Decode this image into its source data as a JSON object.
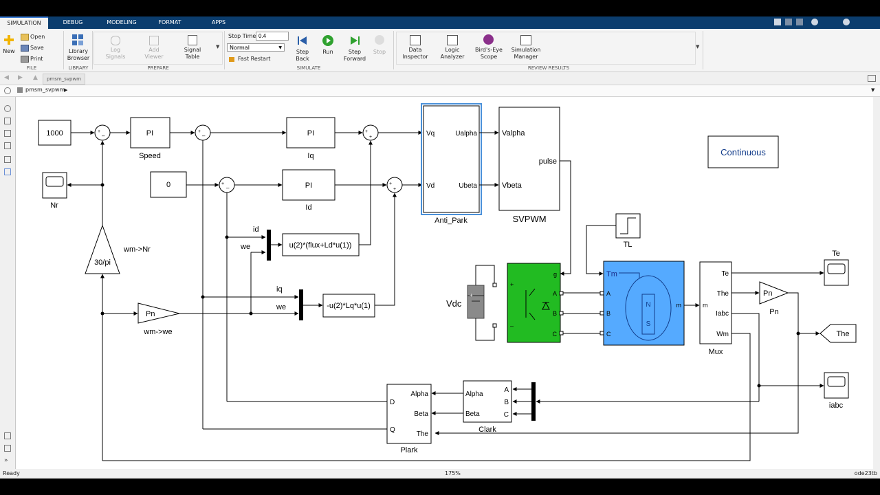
{
  "tabs": [
    "SIMULATION",
    "DEBUG",
    "MODELING",
    "FORMAT",
    "APPS"
  ],
  "ribbon": {
    "file": {
      "new": "New",
      "open": "Open",
      "save": "Save",
      "print": "Print",
      "section": "FILE"
    },
    "library": {
      "browser_l1": "Library",
      "browser_l2": "Browser",
      "section": "LIBRARY"
    },
    "prepare": {
      "log_l1": "Log",
      "log_l2": "Signals",
      "add_l1": "Add",
      "add_l2": "Viewer",
      "signal_l1": "Signal",
      "signal_l2": "Table",
      "section": "PREPARE"
    },
    "simulate": {
      "stop_time_label": "Stop Time",
      "stop_time_value": "0.4",
      "mode": "Normal",
      "fast_restart": "Fast Restart",
      "step_back_l1": "Step",
      "step_back_l2": "Back",
      "run": "Run",
      "step_fwd_l1": "Step",
      "step_fwd_l2": "Forward",
      "stop": "Stop",
      "section": "SIMULATE"
    },
    "review": {
      "di_l1": "Data",
      "di_l2": "Inspector",
      "la_l1": "Logic",
      "la_l2": "Analyzer",
      "be_l1": "Bird's-Eye",
      "be_l2": "Scope",
      "sm_l1": "Simulation",
      "sm_l2": "Manager",
      "section": "REVIEW RESULTS"
    }
  },
  "nav": {
    "model_tab": "pmsm_svpwm"
  },
  "address": {
    "path": "pmsm_svpwm"
  },
  "status": {
    "left": "Ready",
    "zoom": "175%",
    "solver": "ode23tb"
  },
  "diagram": {
    "const1000": "1000",
    "const0": "0",
    "pi": "PI",
    "speed": "Speed",
    "iq": "Iq",
    "id": "Id",
    "nr": "Nr",
    "gain30": "30/pi",
    "wm_nr": "wm->Nr",
    "pn": "Pn",
    "wm_we": "wm->we",
    "anti_park": "Anti_Park",
    "vq": "Vq",
    "vd": "Vd",
    "ualpha": "Ualpha",
    "ubeta": "Ubeta",
    "svpwm": "SVPWM",
    "valpha": "Valpha",
    "vbeta": "Vbeta",
    "pulse": "pulse",
    "continuous": "Continuous",
    "lbl_id": "id",
    "lbl_we": "we",
    "lbl_iq": "iq",
    "fcn1": "u(2)*(flux+Ld*u(1))",
    "fcn2": "-u(2)*Lq*u(1)",
    "tl": "TL",
    "vdc": "Vdc",
    "inv_g": "g",
    "inv_a": "A",
    "inv_b": "B",
    "inv_c": "C",
    "tm": "Tm",
    "motor_m": "m",
    "mot_n": "N",
    "mot_s": "S",
    "mux": "Mux",
    "mux_m": "m",
    "te": "Te",
    "the": "The",
    "iabc": "Iabc",
    "wm": "Wm",
    "pn2": "Pn",
    "te_scope": "Te",
    "the_goto": "The",
    "iabc_scope": "iabc",
    "clark": "Clark",
    "alpha": "Alpha",
    "beta": "Beta",
    "ca": "A",
    "cb": "B",
    "cc": "C",
    "plark": "Plark",
    "d": "D",
    "q": "Q",
    "p_alpha": "Alpha",
    "p_beta": "Beta",
    "p_the": "The"
  },
  "colors": {
    "ribbon_tab_bg": "#0b3d6e",
    "inverter": "#22bb22",
    "motor": "#55aaff",
    "selection": "#4a90d9"
  }
}
